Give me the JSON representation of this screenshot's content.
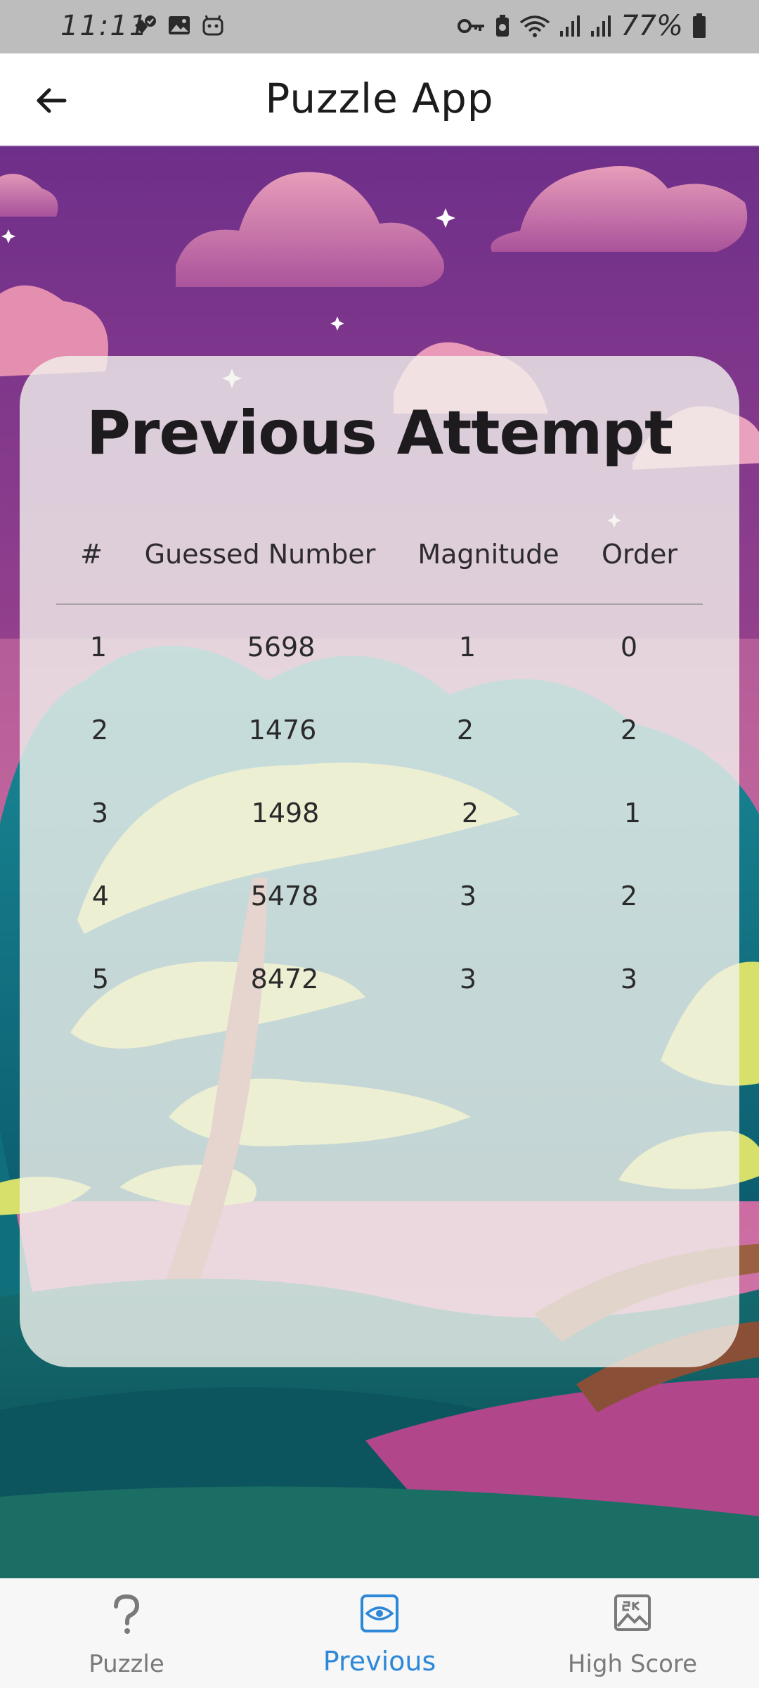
{
  "status_bar": {
    "time": "11:11",
    "battery": "77%"
  },
  "app_bar": {
    "title": "Puzzle App",
    "back_icon": "arrow-left-icon"
  },
  "card": {
    "title": "Previous Attempt",
    "columns": [
      "#",
      "Guessed Number",
      "Magnitude",
      "Order"
    ],
    "rows": [
      [
        "1",
        "5698",
        "1",
        "0"
      ],
      [
        "2",
        "1476",
        "2",
        "2"
      ],
      [
        "3",
        "1498",
        "2",
        "1"
      ],
      [
        "4",
        "5478",
        "3",
        "2"
      ],
      [
        "5",
        "8472",
        "3",
        "3"
      ]
    ]
  },
  "bottom_nav": {
    "items": [
      {
        "label": "Puzzle",
        "icon": "question-icon"
      },
      {
        "label": "Previous",
        "icon": "eye-icon"
      },
      {
        "label": "High Score",
        "icon": "image-icon"
      }
    ],
    "active_index": 1
  },
  "colors": {
    "accent": "#2e88d8",
    "sky_purple": "#7a3a8a",
    "card_bg": "#f2f2ee"
  }
}
